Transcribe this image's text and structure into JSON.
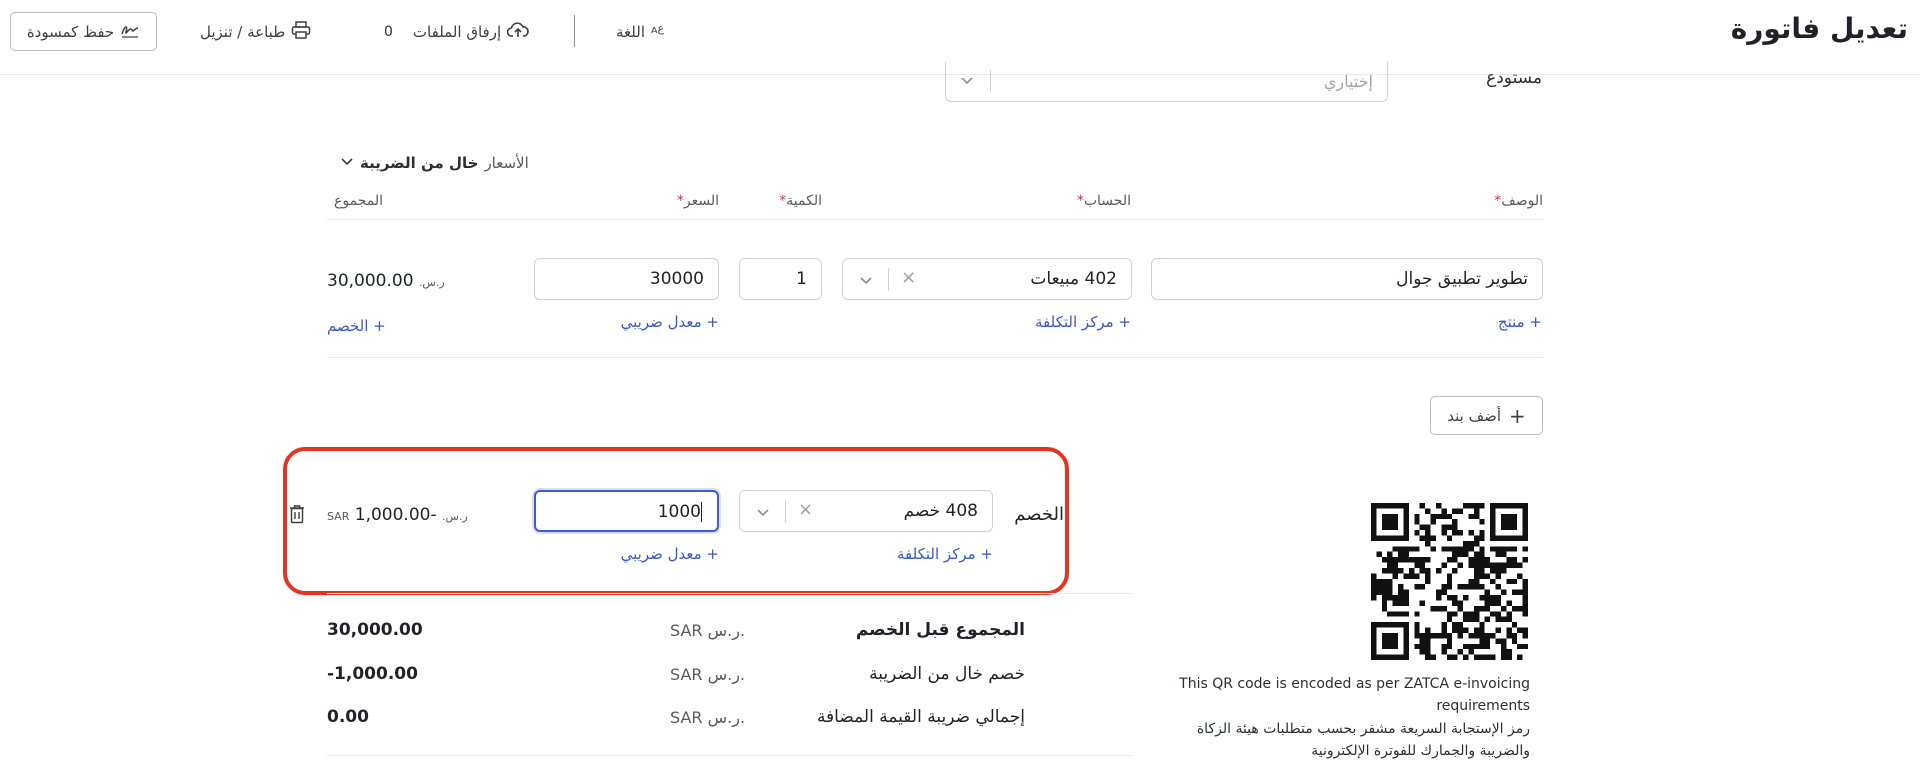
{
  "header": {
    "title": "تعديل فاتورة",
    "language_label": "اللغة",
    "attach_label": "إرفاق الملفات",
    "attach_count": "0",
    "print_label": "طباعة / تنزيل",
    "save_draft_label": "حفظ كمسودة"
  },
  "warehouse": {
    "label": "مستودع",
    "placeholder": "إختياري"
  },
  "price_mode": {
    "prefix": "الأسعار",
    "value": "خال من الضريبة"
  },
  "columns": {
    "description": "الوصف",
    "account": "الحساب",
    "quantity": "الكمية",
    "price": "السعر",
    "total": "المجموع",
    "required_mark": "*"
  },
  "line_item": {
    "description": "تطوير تطبيق جوال",
    "account": "402 مبيعات",
    "quantity": "1",
    "price": "30000",
    "total": "30,000.00",
    "currency_symbol": "ر.س.",
    "add_product": "+ منتج",
    "add_cost_center": "+ مركز التكلفة",
    "add_tax_rate": "+ معدل ضريبي",
    "add_discount": "+ الخصم"
  },
  "add_line_label": "أضف بند",
  "discount": {
    "label": "الخصم",
    "account": "408 خصم",
    "amount_input": "1000",
    "total": "-1,000.00",
    "currency_symbol": "ر.س.",
    "currency_code": "SAR",
    "add_cost_center": "+ مركز التكلفة",
    "add_tax_rate": "+ معدل ضريبي"
  },
  "totals": [
    {
      "label": "المجموع قبل الخصم",
      "currency": "SAR ر.س.",
      "value": "30,000.00"
    },
    {
      "label": "خصم خال من الضريبة",
      "currency": "SAR ر.س.",
      "value": "-1,000.00"
    },
    {
      "label": "إجمالي ضريبة القيمة المضافة",
      "currency": "SAR ر.س.",
      "value": "0.00"
    }
  ],
  "qr": {
    "text_en_line1": "This QR code is encoded as per ZATCA e-invoicing",
    "text_en_line2": "requirements",
    "text_ar_line1": "رمز الإستجابة السريعة مشفر بحسب متطلبات هيئة الزكاة",
    "text_ar_line2": "والضريبة والجمارك للفوترة الإلكترونية"
  },
  "colors": {
    "accent": "#3b57c4",
    "highlight": "#e4341f",
    "required": "#d3344a"
  }
}
